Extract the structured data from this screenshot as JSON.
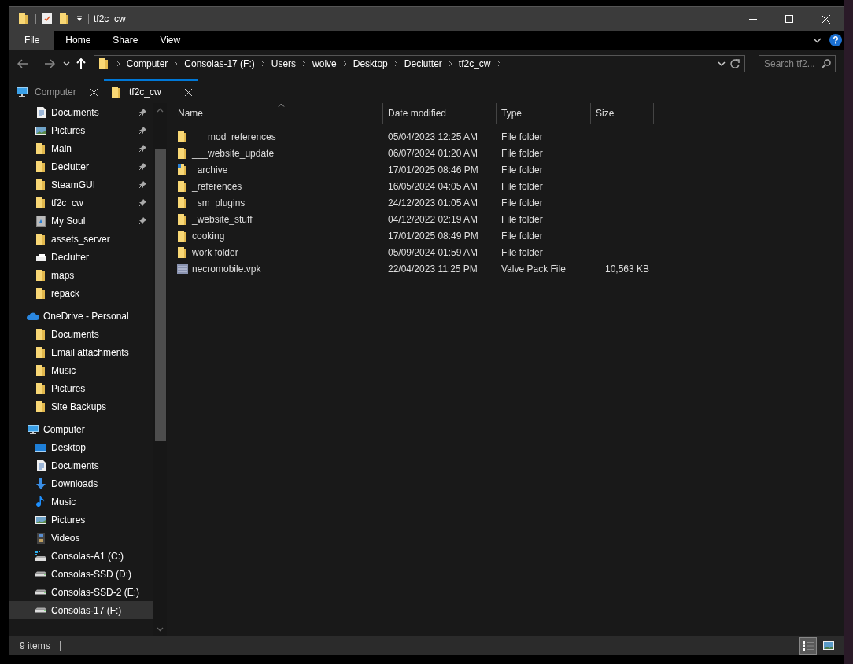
{
  "window": {
    "title": "tf2c_cw"
  },
  "ribbon_tabs": [
    {
      "label": "File",
      "selected": true
    },
    {
      "label": "Home",
      "selected": false
    },
    {
      "label": "Share",
      "selected": false
    },
    {
      "label": "View",
      "selected": false
    }
  ],
  "address_bar": {
    "path": [
      "Computer",
      "Consolas-17 (F:)",
      "Users",
      "wolve",
      "Desktop",
      "Declutter",
      "tf2c_cw"
    ]
  },
  "search": {
    "placeholder": "Search tf2..."
  },
  "folder_tabs": [
    {
      "label": "Computer",
      "kind": "computer",
      "selected": false
    },
    {
      "label": "tf2c_cw",
      "kind": "folder",
      "selected": true
    }
  ],
  "sidebar": {
    "quick_access_items": [
      {
        "label": "Documents",
        "kind": "documents",
        "pinned": true,
        "selected": false
      },
      {
        "label": "Pictures",
        "kind": "pictures",
        "pinned": true,
        "selected": false
      },
      {
        "label": "Main",
        "kind": "folder",
        "pinned": true,
        "selected": false
      },
      {
        "label": "Declutter",
        "kind": "folder",
        "pinned": true,
        "selected": false
      },
      {
        "label": "SteamGUI",
        "kind": "folder",
        "pinned": true,
        "selected": false
      },
      {
        "label": "tf2c_cw",
        "kind": "folder",
        "pinned": true,
        "selected": false
      },
      {
        "label": "My Soul",
        "kind": "recycle",
        "pinned": true,
        "selected": false
      },
      {
        "label": "assets_server",
        "kind": "folder",
        "pinned": false,
        "selected": false
      },
      {
        "label": "Declutter",
        "kind": "tray",
        "pinned": false,
        "selected": false
      },
      {
        "label": "maps",
        "kind": "folder",
        "pinned": false,
        "selected": false
      },
      {
        "label": "repack",
        "kind": "folder",
        "pinned": false,
        "selected": false
      }
    ],
    "nodes": [
      {
        "label": "OneDrive - Personal",
        "kind": "cloud",
        "selected": false,
        "children": [
          {
            "label": "Documents",
            "kind": "folder",
            "selected": false
          },
          {
            "label": "Email attachments",
            "kind": "folder",
            "selected": false
          },
          {
            "label": "Music",
            "kind": "folder",
            "selected": false
          },
          {
            "label": "Pictures",
            "kind": "folder",
            "selected": false
          },
          {
            "label": "Site Backups",
            "kind": "folder",
            "selected": false
          }
        ]
      },
      {
        "label": "Computer",
        "kind": "computer",
        "selected": false,
        "children": [
          {
            "label": "Desktop",
            "kind": "desktop",
            "selected": false
          },
          {
            "label": "Documents",
            "kind": "documents",
            "selected": false
          },
          {
            "label": "Downloads",
            "kind": "downloads",
            "selected": false
          },
          {
            "label": "Music",
            "kind": "music",
            "selected": false
          },
          {
            "label": "Pictures",
            "kind": "pictures",
            "selected": false
          },
          {
            "label": "Videos",
            "kind": "videos",
            "selected": false
          },
          {
            "label": "Consolas-A1 (C:)",
            "kind": "system-drive",
            "selected": false
          },
          {
            "label": "Consolas-SSD (D:)",
            "kind": "drive",
            "selected": false
          },
          {
            "label": "Consolas-SSD-2 (E:)",
            "kind": "drive",
            "selected": false
          },
          {
            "label": "Consolas-17 (F:)",
            "kind": "drive",
            "selected": true
          }
        ]
      }
    ]
  },
  "file_list": {
    "columns": [
      {
        "label": "Name",
        "sorted": true
      },
      {
        "label": "Date modified",
        "sorted": false
      },
      {
        "label": "Type",
        "sorted": false
      },
      {
        "label": "Size",
        "sorted": false
      }
    ],
    "rows": [
      {
        "name": "___mod_references",
        "kind": "folder",
        "date": "05/04/2023 12:25 AM",
        "type": "File folder"
      },
      {
        "name": "___website_update",
        "kind": "folder",
        "date": "06/07/2024 01:20 AM",
        "type": "File folder"
      },
      {
        "name": "_archive",
        "kind": "folder-shortcut",
        "date": "17/01/2025 08:46 PM",
        "type": "File folder"
      },
      {
        "name": "_references",
        "kind": "folder",
        "date": "16/05/2024 04:05 AM",
        "type": "File folder"
      },
      {
        "name": "_sm_plugins",
        "kind": "folder",
        "date": "24/12/2023 01:05 AM",
        "type": "File folder"
      },
      {
        "name": "_website_stuff",
        "kind": "folder",
        "date": "04/12/2022 02:19 AM",
        "type": "File folder"
      },
      {
        "name": "cooking",
        "kind": "folder",
        "date": "17/01/2025 08:49 PM",
        "type": "File folder"
      },
      {
        "name": "work folder",
        "kind": "folder",
        "date": "05/09/2024 01:59 AM",
        "type": "File folder"
      },
      {
        "name": "necromobile.vpk",
        "kind": "file",
        "date": "22/04/2023 11:25 PM",
        "type": "Valve Pack File",
        "size": "10,563 KB"
      }
    ]
  },
  "status_bar": {
    "item_count": "9 items",
    "view_buttons": [
      {
        "kind": "details",
        "selected": true
      },
      {
        "kind": "thumbnails",
        "selected": false
      }
    ]
  }
}
